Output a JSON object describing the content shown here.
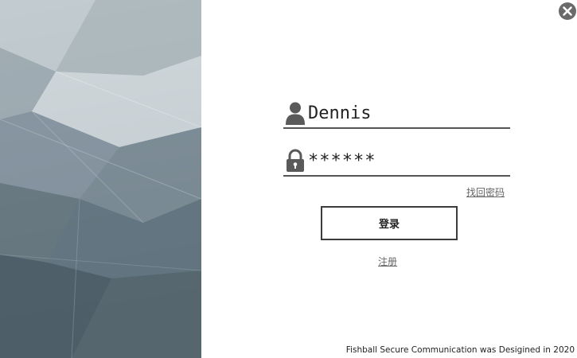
{
  "login": {
    "username_value": "Dennis",
    "password_value": "******",
    "forgot_password_label": "找回密码",
    "login_button_label": "登录",
    "register_label": "注册"
  },
  "footer": {
    "credit_text": "Fishball Secure Communication was Desigined in 2020"
  },
  "icons": {
    "close": "close-icon",
    "user": "user-icon",
    "lock": "lock-icon"
  },
  "colors": {
    "accent_dark": "#3c3c3c",
    "underline": "#555555",
    "link_text": "#666666",
    "close_button": "#6a6a6a"
  }
}
